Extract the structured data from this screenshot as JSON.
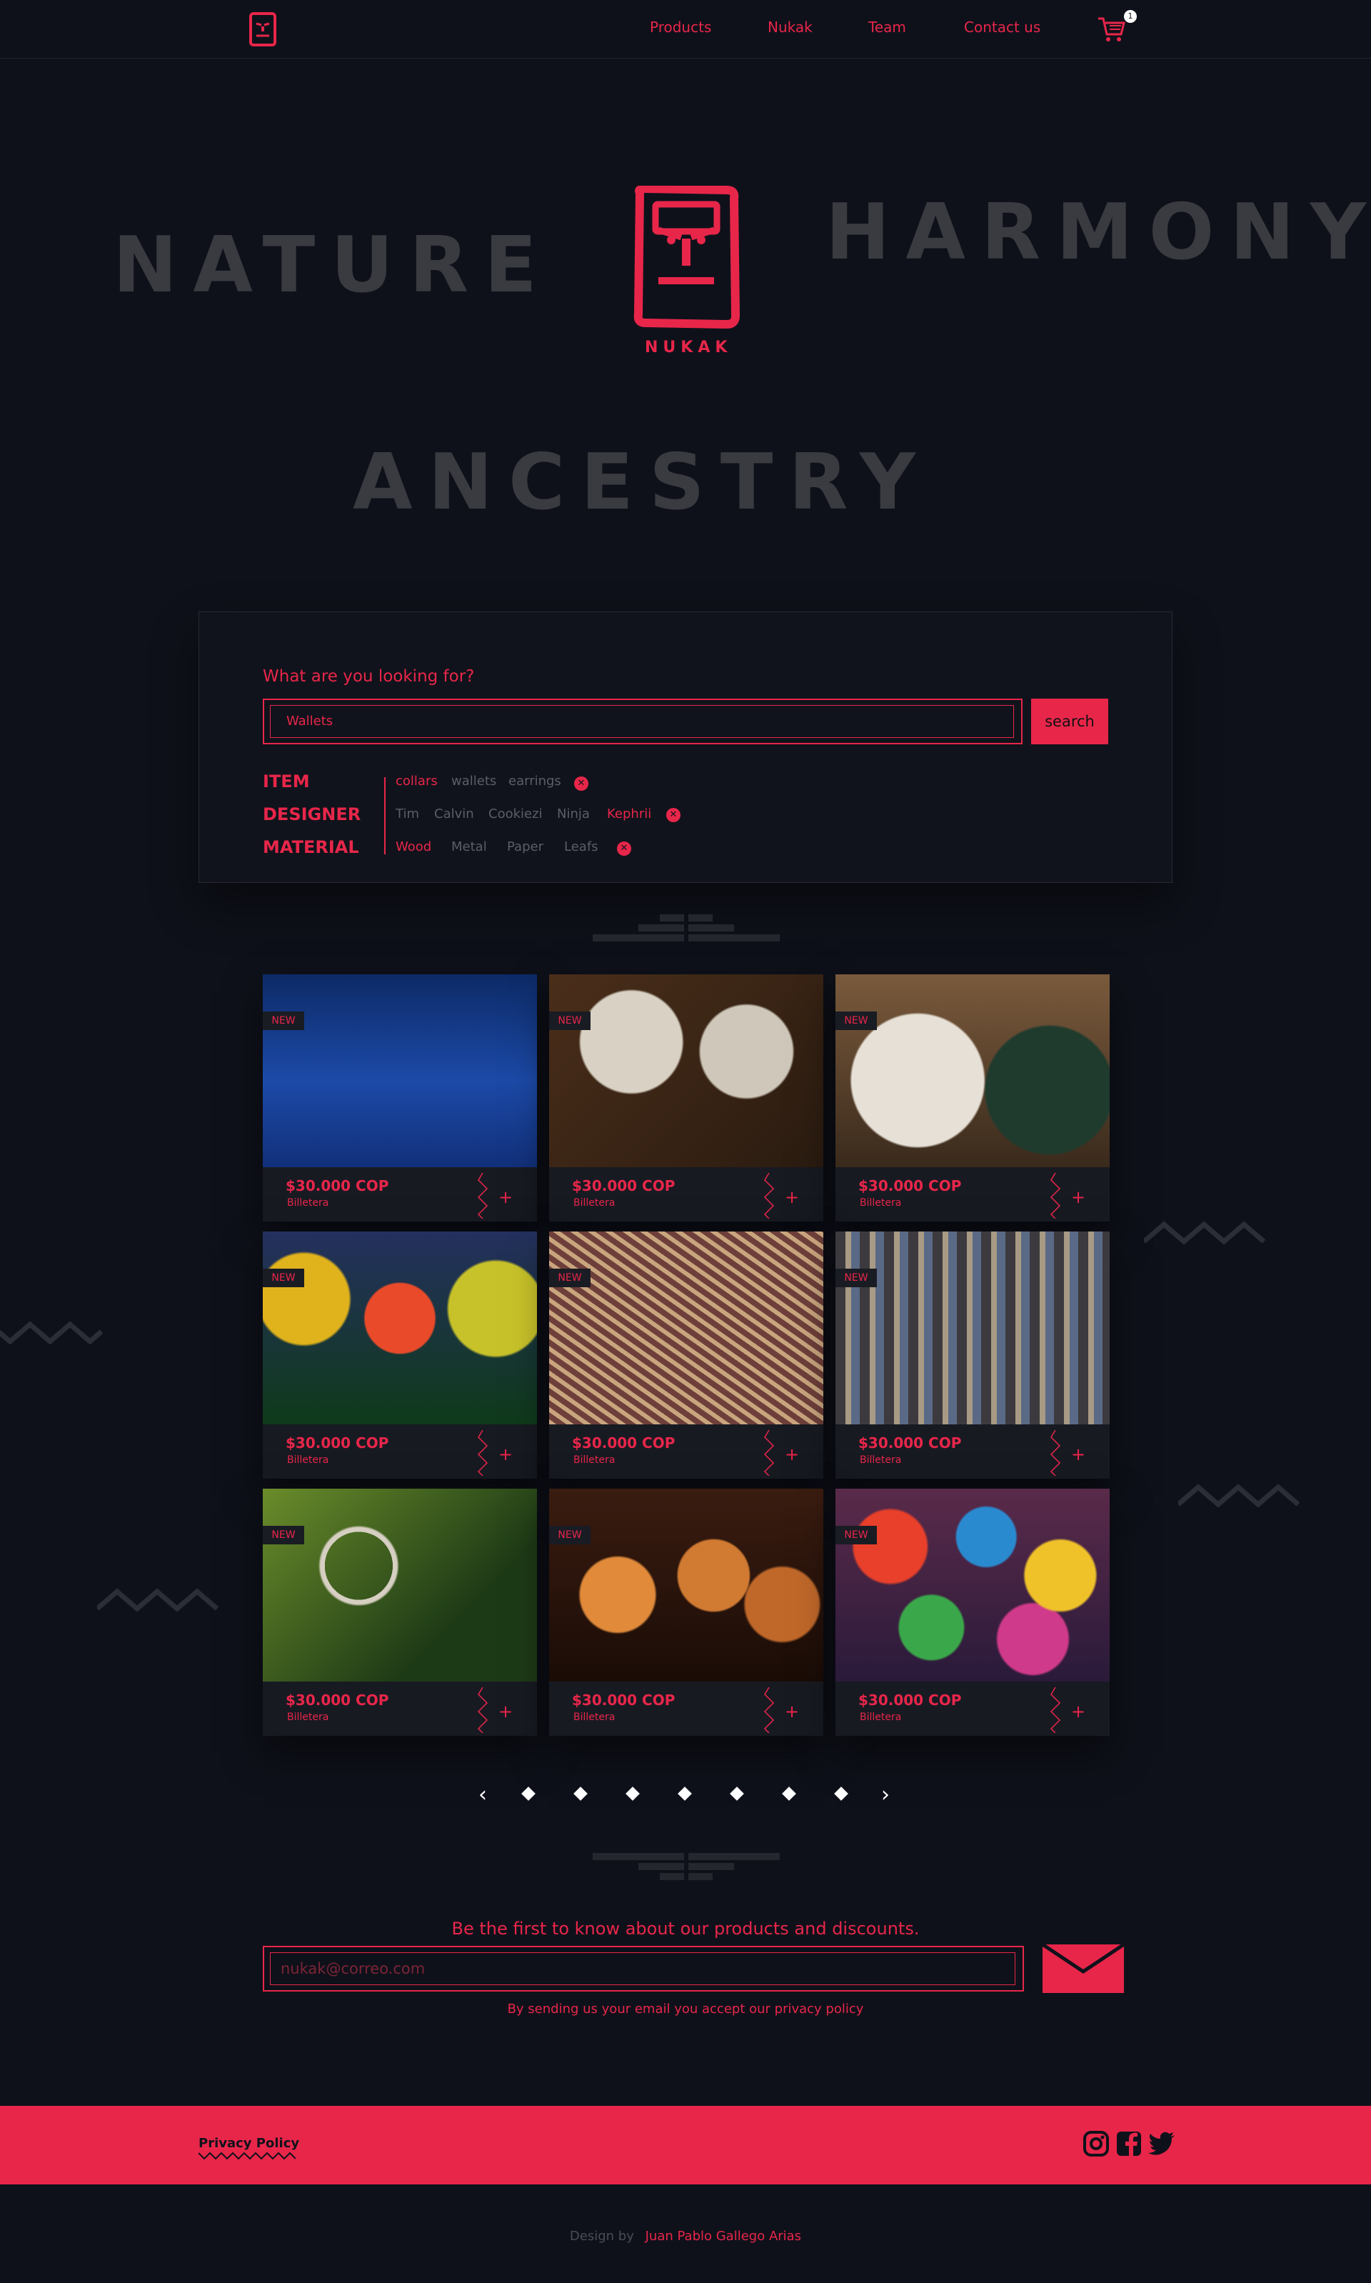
{
  "header": {
    "nav": [
      "Products",
      "Nukak",
      "Team",
      "Contact us"
    ],
    "cart_count": "1"
  },
  "hero": {
    "words": [
      "NATURE",
      "HARMONY",
      "ANCESTRY"
    ],
    "brand": "NUKAK"
  },
  "search": {
    "prompt": "What are you looking for?",
    "value": "Wallets",
    "button": "search"
  },
  "filters": [
    {
      "label": "ITEM",
      "options": [
        {
          "text": "collars",
          "selected": true
        },
        {
          "text": "wallets",
          "selected": false
        },
        {
          "text": "earrings",
          "selected": false
        }
      ]
    },
    {
      "label": "DESIGNER",
      "options": [
        {
          "text": "Tim",
          "selected": false
        },
        {
          "text": "Calvin",
          "selected": false
        },
        {
          "text": "Cookiezi",
          "selected": false
        },
        {
          "text": "Ninja",
          "selected": false
        },
        {
          "text": "Kephrii",
          "selected": true
        }
      ]
    },
    {
      "label": "MATERIAL",
      "options": [
        {
          "text": "Wood",
          "selected": true
        },
        {
          "text": "Metal",
          "selected": false
        },
        {
          "text": "Paper",
          "selected": false
        },
        {
          "text": "Leafs",
          "selected": false
        }
      ]
    }
  ],
  "products": [
    {
      "badge": "NEW",
      "price": "$30.000 COP",
      "name": "Billetera",
      "image": "earrings"
    },
    {
      "badge": "NEW",
      "price": "$30.000 COP",
      "name": "Billetera",
      "image": "plates"
    },
    {
      "badge": "NEW",
      "price": "$30.000 COP",
      "name": "Billetera",
      "image": "woven-bags"
    },
    {
      "badge": "NEW",
      "price": "$30.000 COP",
      "name": "Billetera",
      "image": "skulls"
    },
    {
      "badge": "NEW",
      "price": "$30.000 COP",
      "name": "Billetera",
      "image": "baskets"
    },
    {
      "badge": "NEW",
      "price": "$30.000 COP",
      "name": "Billetera",
      "image": "necklaces"
    },
    {
      "badge": "NEW",
      "price": "$30.000 COP",
      "name": "Billetera",
      "image": "dreamcatcher"
    },
    {
      "badge": "NEW",
      "price": "$30.000 COP",
      "name": "Billetera",
      "image": "lamps"
    },
    {
      "badge": "NEW",
      "price": "$30.000 COP",
      "name": "Billetera",
      "image": "painted-plates"
    }
  ],
  "pagination": {
    "pages": 7
  },
  "newsletter": {
    "title": "Be the first to know about our products and discounts.",
    "placeholder": "nukak@correo.com",
    "note": "By sending us your email you accept our privacy policy"
  },
  "footer": {
    "privacy": "Privacy Policy",
    "social": [
      "instagram-icon",
      "facebook-icon",
      "twitter-icon"
    ]
  },
  "credit": {
    "prefix": "Design by",
    "author": "Juan Pablo Gallego Arias"
  },
  "colors": {
    "background": "#0f111a",
    "accent": "#e8264a",
    "muted": "#393b41"
  }
}
